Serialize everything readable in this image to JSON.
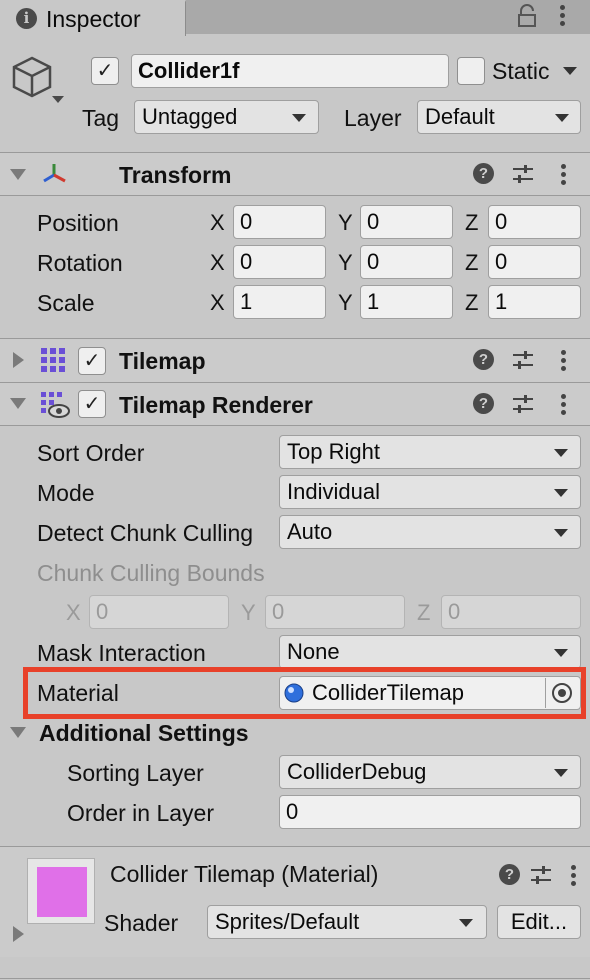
{
  "window": {
    "tab_label": "Inspector"
  },
  "object": {
    "active": true,
    "name": "Collider1f",
    "static_label": "Static",
    "static_checked": false,
    "tag_label": "Tag",
    "tag_value": "Untagged",
    "layer_label": "Layer",
    "layer_value": "Default"
  },
  "transform": {
    "title": "Transform",
    "rows": [
      {
        "label": "Position",
        "x": "0",
        "y": "0",
        "z": "0"
      },
      {
        "label": "Rotation",
        "x": "0",
        "y": "0",
        "z": "0"
      },
      {
        "label": "Scale",
        "x": "1",
        "y": "1",
        "z": "1"
      }
    ],
    "axis": {
      "x": "X",
      "y": "Y",
      "z": "Z"
    }
  },
  "tilemap": {
    "title": "Tilemap",
    "enabled": true
  },
  "renderer": {
    "title": "Tilemap Renderer",
    "enabled": true,
    "sort_order_label": "Sort Order",
    "sort_order_value": "Top Right",
    "mode_label": "Mode",
    "mode_value": "Individual",
    "detect_label": "Detect Chunk Culling",
    "detect_value": "Auto",
    "bounds_label": "Chunk Culling Bounds",
    "bounds": {
      "x": "0",
      "y": "0",
      "z": "0"
    },
    "mask_label": "Mask Interaction",
    "mask_value": "None",
    "material_label": "Material",
    "material_value": "ColliderTilemap",
    "additional_label": "Additional Settings",
    "sorting_layer_label": "Sorting Layer",
    "sorting_layer_value": "ColliderDebug",
    "order_label": "Order in Layer",
    "order_value": "0"
  },
  "material": {
    "title": "Collider Tilemap (Material)",
    "shader_label": "Shader",
    "shader_value": "Sprites/Default",
    "edit_label": "Edit...",
    "swatch_color": "#e070e8"
  },
  "colors": {
    "highlight": "#e8412a"
  }
}
